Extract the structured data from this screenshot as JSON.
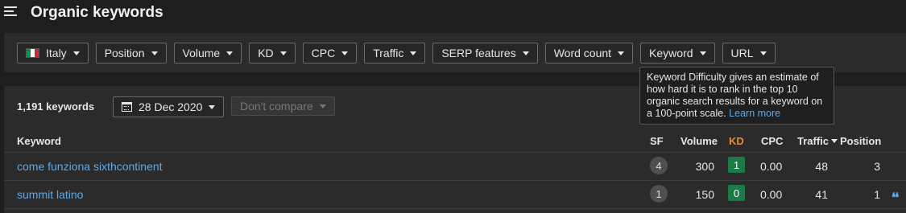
{
  "header": {
    "title": "Organic keywords"
  },
  "filters": {
    "country": "Italy",
    "country_flag_colors": [
      "#009246",
      "#ffffff",
      "#ce2b37"
    ],
    "position": "Position",
    "volume": "Volume",
    "kd": "KD",
    "cpc": "CPC",
    "traffic": "Traffic",
    "serp_features": "SERP features",
    "word_count": "Word count",
    "keyword": "Keyword",
    "url": "URL"
  },
  "tooltip": {
    "text": "Keyword Difficulty gives an estimate of how hard it is to rank in the top 10 organic search results for a keyword on a 100-point scale.",
    "link": "Learn more"
  },
  "results": {
    "count": "1,191 keywords",
    "date": "28 Dec 2020",
    "compare": "Don't compare"
  },
  "table": {
    "columns": {
      "keyword": "Keyword",
      "sf": "SF",
      "volume": "Volume",
      "kd": "KD",
      "cpc": "CPC",
      "traffic": "Traffic",
      "position": "Position"
    },
    "rows": [
      {
        "keyword": "come funziona sixthcontinent",
        "sf": "4",
        "volume": "300",
        "kd": "1",
        "cpc": "0.00",
        "traffic": "48",
        "position": "3"
      },
      {
        "keyword": "summit latino",
        "sf": "1",
        "volume": "150",
        "kd": "0",
        "cpc": "0.00",
        "traffic": "41",
        "position": "1"
      }
    ]
  },
  "colors": {
    "kd_easy": "#1b7a45",
    "link": "#5ea9e6",
    "kd_header": "#f0892a"
  }
}
